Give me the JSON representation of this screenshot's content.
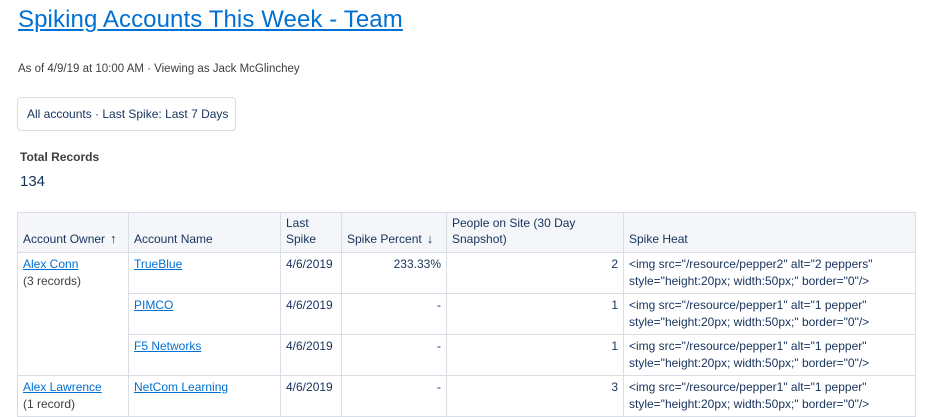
{
  "report": {
    "title": "Spiking Accounts This Week - Team",
    "subtitle": "As of 4/9/19 at 10:00 AM · Viewing as Jack McGlinchey",
    "filter": "All accounts · Last Spike: Last 7 Days",
    "total_label": "Total Records",
    "total_value": "134"
  },
  "table": {
    "headers": {
      "owner": "Account Owner",
      "owner_sort": "↑",
      "name": "Account Name",
      "last_spike": "Last Spike",
      "spike_percent": "Spike Percent",
      "spike_sort": "↓",
      "people": "People on Site (30 Day Snapshot)",
      "heat": "Spike Heat"
    },
    "groups": [
      {
        "owner": "Alex Conn",
        "count": "(3 records)",
        "rows": [
          {
            "name": "TrueBlue",
            "last_spike": "4/6/2019",
            "spike_percent": "233.33%",
            "people": "2",
            "heat": "<img src=\"/resource/pepper2\" alt=\"2 peppers\" style=\"height:20px; width:50px;\" border=\"0\"/>"
          },
          {
            "name": "PIMCO",
            "last_spike": "4/6/2019",
            "spike_percent": "-",
            "people": "1",
            "heat": "<img src=\"/resource/pepper1\" alt=\"1 pepper\" style=\"height:20px; width:50px;\" border=\"0\"/>"
          },
          {
            "name": "F5 Networks",
            "last_spike": "4/6/2019",
            "spike_percent": "-",
            "people": "1",
            "heat": "<img src=\"/resource/pepper1\" alt=\"1 pepper\" style=\"height:20px; width:50px;\" border=\"0\"/>"
          }
        ]
      },
      {
        "owner": "Alex Lawrence",
        "count": "(1 record)",
        "rows": [
          {
            "name": "NetCom Learning",
            "last_spike": "4/6/2019",
            "spike_percent": "-",
            "people": "3",
            "heat": "<img src=\"/resource/pepper1\" alt=\"1 pepper\" style=\"height:20px; width:50px;\" border=\"0\"/>"
          }
        ]
      }
    ]
  }
}
